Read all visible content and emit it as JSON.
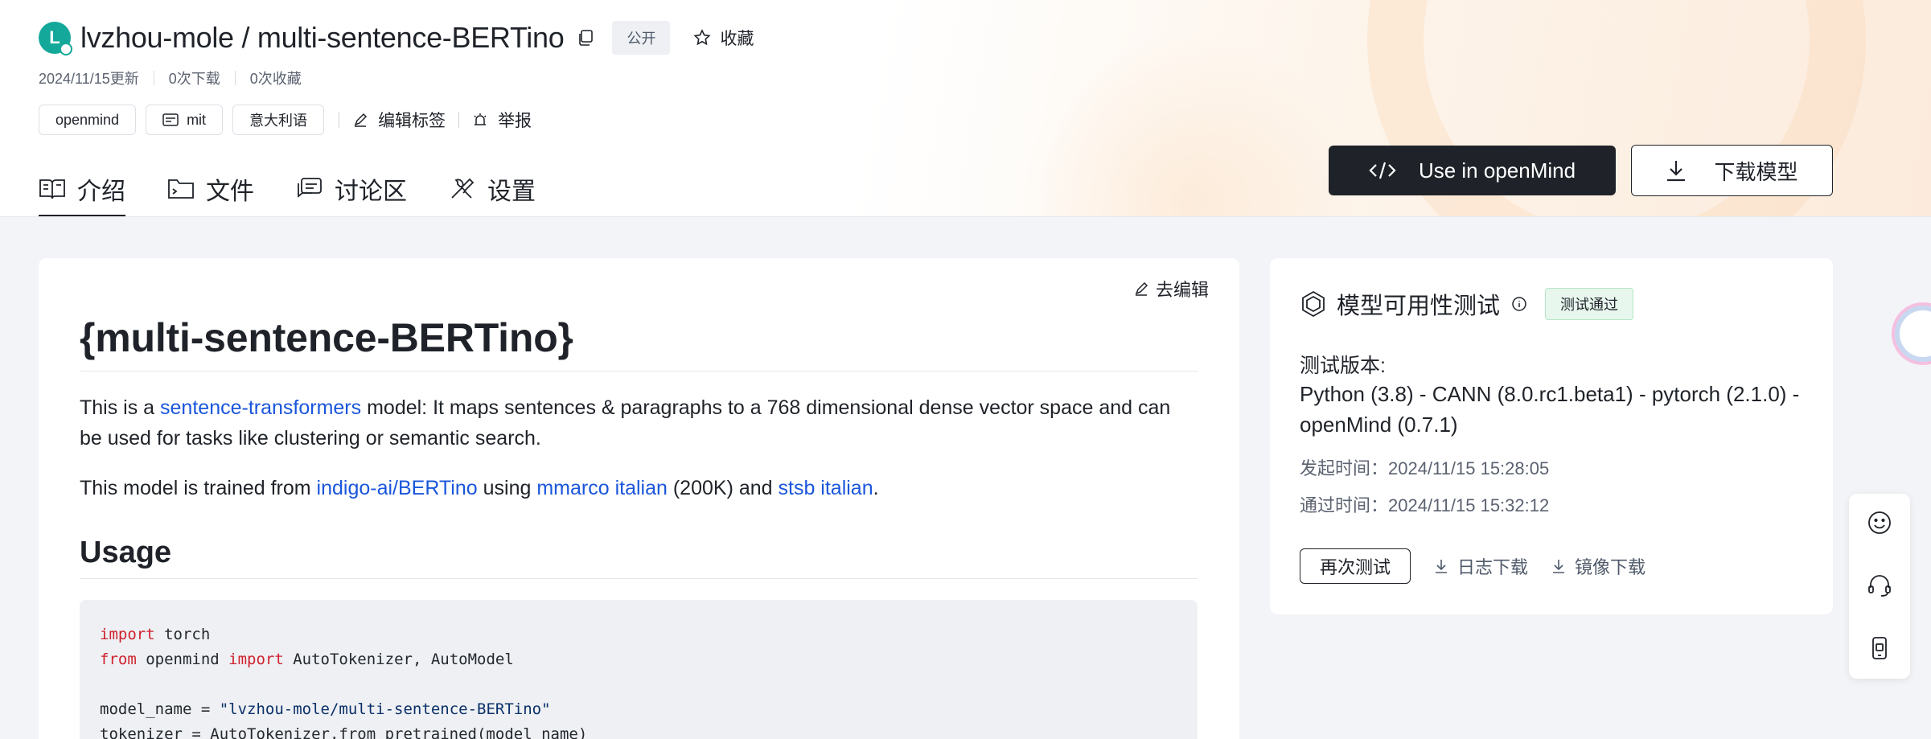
{
  "header": {
    "avatar_letter": "L",
    "repo_title": "lvzhou-mole / multi-sentence-BERTino",
    "visibility": "公开",
    "favorite_label": "收藏",
    "updated": "2024/11/15更新",
    "downloads": "0次下载",
    "favorites": "0次收藏",
    "tags": [
      "openmind",
      "mit",
      "意大利语"
    ],
    "edit_tags_label": "编辑标签",
    "report_label": "举报"
  },
  "tabs": [
    {
      "label": "介绍",
      "icon": "book-icon",
      "active": true
    },
    {
      "label": "文件",
      "icon": "folder-icon",
      "active": false
    },
    {
      "label": "讨论区",
      "icon": "chat-icon",
      "active": false
    },
    {
      "label": "设置",
      "icon": "tools-icon",
      "active": false
    }
  ],
  "actions": {
    "use_in": "Use in openMind",
    "download": "下载模型"
  },
  "main": {
    "edit_label": "去编辑",
    "h1": "{multi-sentence-BERTino}",
    "p1_pre": "This is a ",
    "p1_link": "sentence-transformers",
    "p1_post": " model: It maps sentences & paragraphs to a 768 dimensional dense vector space and can be used for tasks like clustering or semantic search.",
    "p2_pre": "This model is trained from ",
    "p2_link1": "indigo-ai/BERTino",
    "p2_mid1": " using ",
    "p2_link2": "mmarco italian",
    "p2_mid2": " (200K) and ",
    "p2_link3": "stsb italian",
    "p2_post": ".",
    "h2": "Usage",
    "code": {
      "l1_kw": "import",
      "l1_rest": " torch",
      "l2_kw1": "from",
      "l2_mid": " openmind ",
      "l2_kw2": "import",
      "l2_rest": " AutoTokenizer, AutoModel",
      "l4_pre": "model_name = ",
      "l4_str": "\"lvzhou-mole/multi-sentence-BERTino\"",
      "l5": "tokenizer = AutoTokenizer.from_pretrained(model_name)"
    }
  },
  "side": {
    "title": "模型可用性测试",
    "badge": "测试通过",
    "version_label": "测试版本:",
    "version_text": "Python (3.8) - CANN (8.0.rc1.beta1) - pytorch (2.1.0) - openMind (0.7.1)",
    "start_time": "发起时间：2024/11/15 15:28:05",
    "pass_time": "通过时间：2024/11/15 15:32:12",
    "retest": "再次测试",
    "log_download": "日志下载",
    "image_download": "镜像下载"
  }
}
